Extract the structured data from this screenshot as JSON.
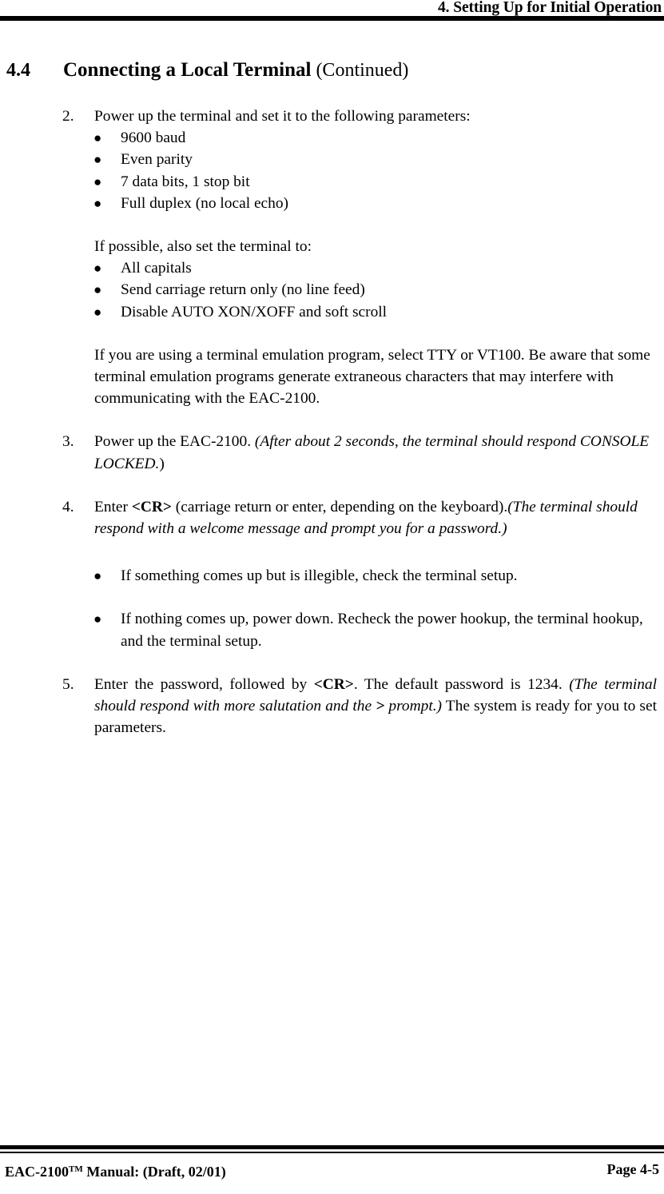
{
  "header": {
    "title": "4. Setting Up for Initial Operation"
  },
  "section": {
    "number": "4.4",
    "title": "Connecting a Local Terminal",
    "continued": " (Continued)"
  },
  "steps": {
    "step2": {
      "marker": "2.",
      "text": "Power up the terminal and set it to the following parameters:",
      "bullets": [
        "9600 baud",
        "Even parity",
        "7 data bits, 1 stop bit",
        "Full duplex (no local echo)"
      ]
    },
    "intro2b": {
      "text": "If possible, also set the terminal to:",
      "bullets": [
        "All capitals",
        "Send carriage return only (no line feed)",
        "Disable AUTO XON/XOFF and soft scroll"
      ]
    },
    "para_emulation": {
      "text": "If you are using a terminal emulation program, select TTY or VT100. Be aware that some terminal emulation programs generate extraneous characters that may interfere with communicating with the EAC-2100."
    },
    "step3": {
      "marker": "3.",
      "lead": "Power up the EAC-2100. ",
      "italic": "(After about 2 seconds, the terminal should respond CONSOLE LOCKED.",
      "tail": ")"
    },
    "step4": {
      "marker": "4.",
      "lead": "Enter ",
      "bold": "<CR>",
      "mid": " (carriage return or enter, depending on the keyboard).",
      "italic": "(The terminal should respond with a welcome message and prompt you for a password.)",
      "bullets": [
        "If something comes up but is illegible, check the terminal setup.",
        "If nothing comes up, power down. Recheck the power hookup, the terminal hookup, and the terminal setup."
      ]
    },
    "step5": {
      "marker": "5.",
      "lead": "Enter the password, followed by ",
      "bold": "<CR>",
      "mid": ". The default password is 1234. ",
      "italic_a": "(The terminal should respond with more salutation and the ",
      "italic_bold": ">",
      "italic_b": " prompt.)",
      "tail": " The system is ready for you to set parameters."
    }
  },
  "footer": {
    "left_a": "EAC-2100",
    "left_tm": "TM",
    "left_b": " Manual: (Draft, 02/01)",
    "right": "Page 4-5"
  }
}
